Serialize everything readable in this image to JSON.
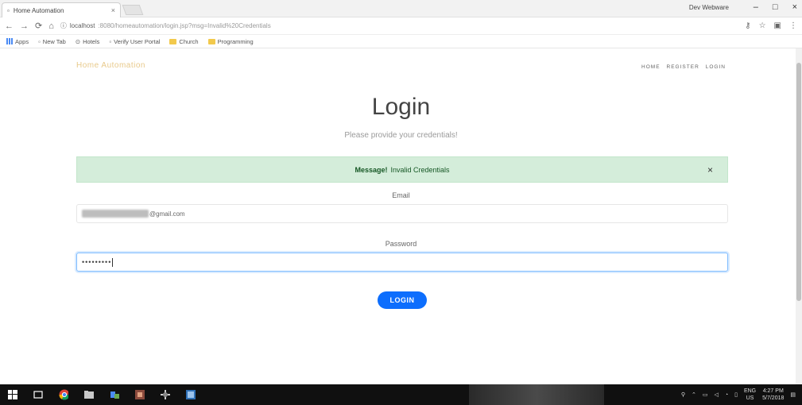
{
  "browser": {
    "tab_title": "Home Automation",
    "tab_close": "×",
    "window_user": "Dev Webware",
    "window_controls": [
      "–",
      "□",
      "×"
    ],
    "url_host": "localhost",
    "url_path": ":8080/homeautomation/login.jsp?msg=Invalid%20Credentials",
    "bookmarks": [
      "Apps",
      "New Tab",
      "Hotels",
      "Verify User Portal",
      "Church",
      "Programming"
    ]
  },
  "site": {
    "brand": "Home Automation",
    "nav": [
      "HOME",
      "REGISTER",
      "LOGIN"
    ]
  },
  "login": {
    "title": "Login",
    "subtitle": "Please provide your credentials!",
    "alert_label": "Message!",
    "alert_text": "Invalid Credentials",
    "alert_close": "×",
    "email_label": "Email",
    "email_value": "@gmail.com",
    "password_label": "Password",
    "password_value": "•••••••••",
    "button_label": "LOGIN"
  },
  "taskbar": {
    "lang_top": "ENG",
    "lang_bottom": "US",
    "time": "4:27 PM",
    "date": "5/7/2018"
  },
  "colors": {
    "accent": "#0d6efd",
    "alert_bg": "#d4edda",
    "brand": "#e8c98a"
  }
}
